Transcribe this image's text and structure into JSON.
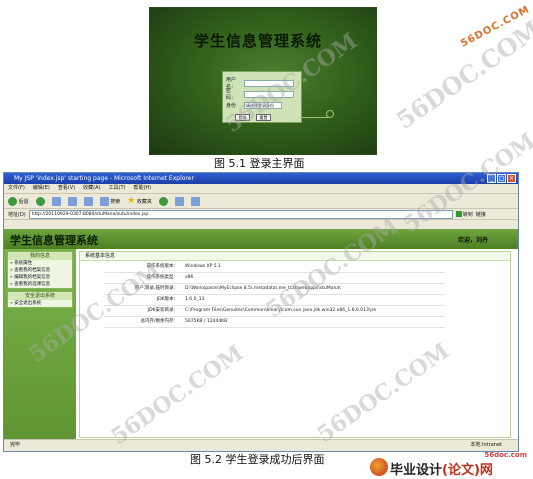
{
  "figure1": {
    "title": "学生信息管理系统",
    "fields": [
      {
        "label": "用户名：",
        "value": ""
      },
      {
        "label": "密　码：",
        "value": ""
      }
    ],
    "role_label": "身份",
    "role_select": "请选择登录身份",
    "buttons": [
      "登录",
      "重置"
    ],
    "caption": "图 5.1  登录主界面"
  },
  "figure2": {
    "window_title": "My JSP 'index.jsp' starting page - Microsoft Internet Explorer",
    "menu": [
      "文件(F)",
      "编辑(E)",
      "查看(V)",
      "收藏(A)",
      "工具(T)",
      "帮助(H)"
    ],
    "toolbar": {
      "back": "后退",
      "search": "搜索",
      "favorites": "收藏夹"
    },
    "address_label": "地址(D)",
    "address": "http://20110929-0307:8080/stuMana/zutu/index.jsp",
    "go_label": "转到",
    "links_label": "链接",
    "app_title": "学生信息管理系统",
    "welcome": "欢迎，刘丹",
    "sidebar": [
      {
        "heading": "我的信息",
        "items": [
          "系统属性",
          "查看我的档案信息",
          "编辑我的档案信息",
          "查看我的选课信息"
        ]
      },
      {
        "heading": "安全退出系统",
        "items": [
          "安全退出系统"
        ]
      }
    ],
    "panel_title": "系统基本信息",
    "info": [
      {
        "key": "操作系统版本：",
        "value": "Windows XP 5.1"
      },
      {
        "key": "操作系统类型：",
        "value": "x86"
      },
      {
        "key": "用户,目录,临时目录：",
        "value": "D:\\Workspaces\\MyEclipse 8.5\\.metadata\\.me_tcat\\webapps\\stuMana\\"
      },
      {
        "key": "JDK版本：",
        "value": "1.6.0_13"
      },
      {
        "key": "JDK安装目录：",
        "value": "C:\\Program Files\\Genuitec\\Common\\binary\\com.sun.java.jdk.win32.x86_1.6.0.013\\jre"
      },
      {
        "key": "总内存/剩余内存：",
        "value": "5075KB / 12444KB"
      }
    ],
    "status_left": "完毕",
    "status_right": "本地 Intranet",
    "caption": "图 5.2  学生登录成功后界面"
  },
  "watermark": "56DOC.COM",
  "site_url": "56DOC.COM",
  "logo": {
    "url": "56doc.com",
    "text": "毕业设计",
    "suffix": "(论文)网"
  }
}
